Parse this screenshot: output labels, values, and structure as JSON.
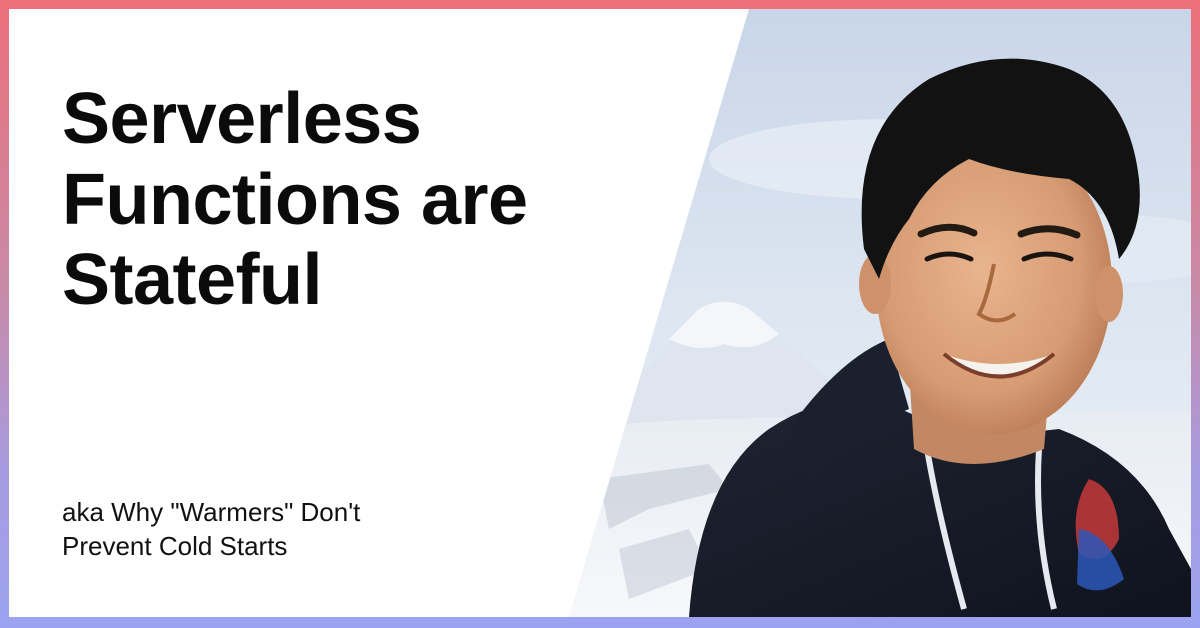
{
  "card": {
    "title_lines": [
      "Serverless",
      "Functions are",
      "Stateful"
    ],
    "subtitle_lines": [
      "aka Why \"Warmers\" Don't",
      "Prevent Cold Starts"
    ]
  },
  "colors": {
    "frame_gradient_top": "#ec6f7a",
    "frame_gradient_bottom": "#9ba3f0",
    "card_background": "#ffffff",
    "title_color": "#0b0b0b"
  },
  "photo": {
    "subject": "smiling-man-selfie",
    "background": "snowy-mountain-landscape"
  }
}
